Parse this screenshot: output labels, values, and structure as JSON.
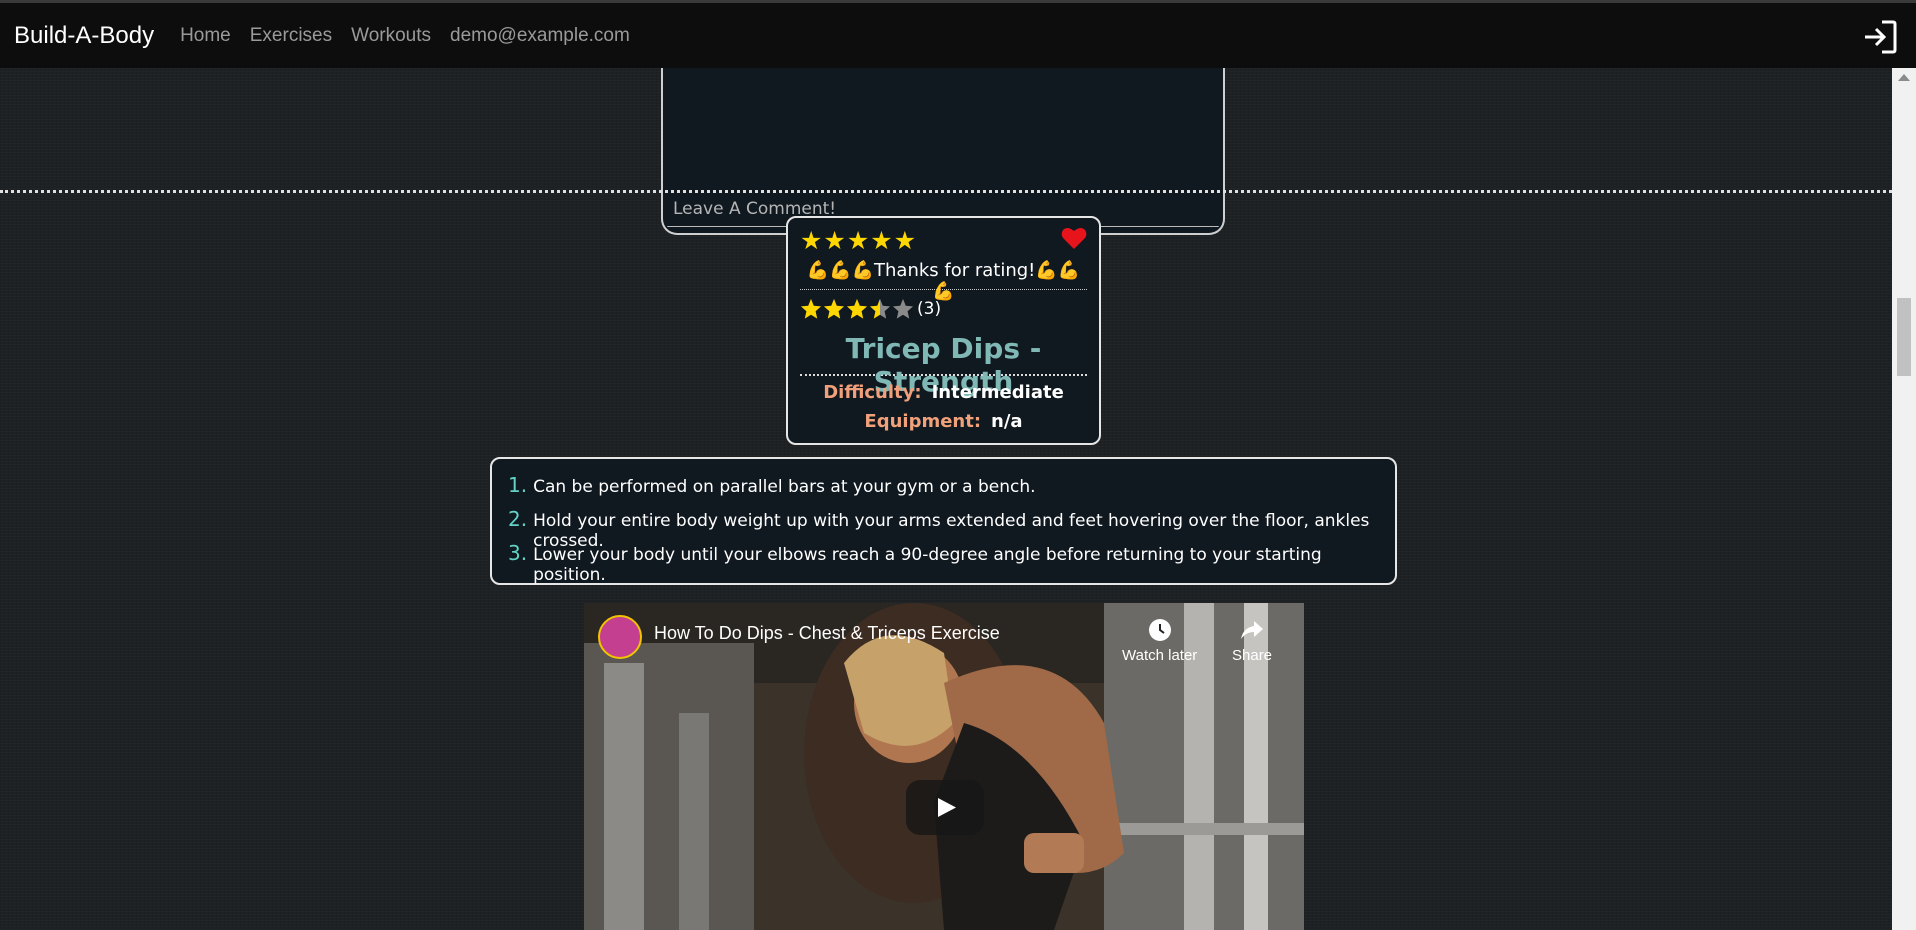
{
  "navbar": {
    "brand": "Build-A-Body",
    "links": [
      "Home",
      "Exercises",
      "Workouts",
      "demo@example.com"
    ],
    "logout_icon": "logout-icon"
  },
  "comment": {
    "placeholder": "Leave A Comment!"
  },
  "exercise": {
    "user_rating": 5,
    "user_stars": "★★★★★",
    "favorite_icon": "heart-icon",
    "favorited": true,
    "thanks_text": "💪💪💪Thanks for rating!💪💪💪",
    "average_rating": 3.5,
    "rating_count": "(3)",
    "title": "Tricep Dips - Strength",
    "difficulty_label": "Difficulty:",
    "difficulty": "Intermediate",
    "equipment_label": "Equipment:",
    "equipment": "n/a",
    "colors": {
      "star": "#ffd700",
      "title": "#7fb8b4",
      "label": "#f0a07a",
      "step_number": "#62d3c6",
      "heart": "#e8141b"
    }
  },
  "steps": [
    {
      "num": "1.",
      "text": "Can be performed on parallel bars at your gym or a bench."
    },
    {
      "num": "2.",
      "text": "Hold your entire body weight up with your arms extended and feet hovering over the floor, ankles crossed."
    },
    {
      "num": "3.",
      "text": "Lower your body until your elbows reach a 90-degree angle before returning to your starting position."
    }
  ],
  "video": {
    "title": "How To Do Dips - Chest & Triceps Exercise",
    "watch_later": "Watch later",
    "share": "Share"
  }
}
